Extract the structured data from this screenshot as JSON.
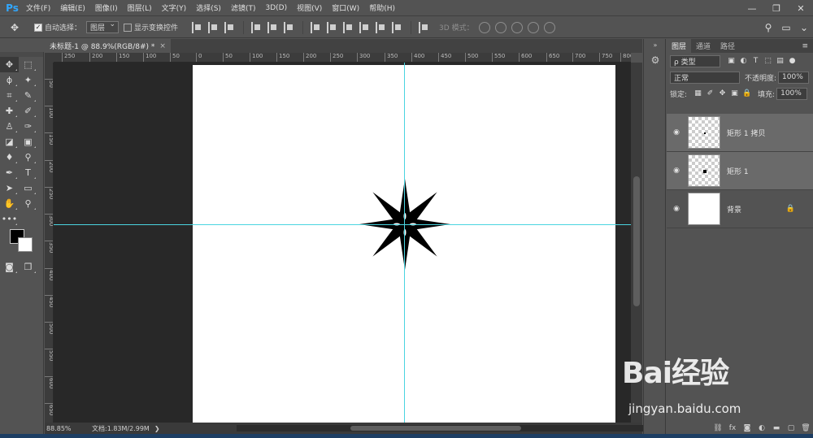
{
  "app": {
    "logo": "Ps"
  },
  "menu": {
    "items": [
      "文件(F)",
      "编辑(E)",
      "图像(I)",
      "图层(L)",
      "文字(Y)",
      "选择(S)",
      "滤镜(T)",
      "3D(D)",
      "视图(V)",
      "窗口(W)",
      "帮助(H)"
    ]
  },
  "window_controls": {
    "minimize": "—",
    "restore": "❐",
    "close": "✕"
  },
  "options": {
    "auto_select_label": "自动选择：",
    "auto_select_value": "图层",
    "show_transform_label": "显示变换控件",
    "mode3d_label": "3D 模式："
  },
  "document": {
    "tab_title": "未标题-1 @ 88.9%(RGB/8#) *",
    "tab_close": "×",
    "zoom": "88.85%",
    "doc_info": "文档:1.83M/2.99M"
  },
  "rulers": {
    "h_ticks": [
      {
        "label": "250",
        "pos": 10
      },
      {
        "label": "200",
        "pos": 44
      },
      {
        "label": "150",
        "pos": 77
      },
      {
        "label": "100",
        "pos": 110
      },
      {
        "label": "50",
        "pos": 143
      },
      {
        "label": "0",
        "pos": 175
      },
      {
        "label": "50",
        "pos": 208
      },
      {
        "label": "100",
        "pos": 241
      },
      {
        "label": "150",
        "pos": 274
      },
      {
        "label": "200",
        "pos": 307
      },
      {
        "label": "250",
        "pos": 340
      },
      {
        "label": "300",
        "pos": 373
      },
      {
        "label": "350",
        "pos": 407
      },
      {
        "label": "400",
        "pos": 440
      },
      {
        "label": "450",
        "pos": 473
      },
      {
        "label": "500",
        "pos": 506
      },
      {
        "label": "550",
        "pos": 539
      },
      {
        "label": "600",
        "pos": 572
      },
      {
        "label": "650",
        "pos": 606
      },
      {
        "label": "700",
        "pos": 638
      },
      {
        "label": "750",
        "pos": 671
      },
      {
        "label": "800",
        "pos": 697
      }
    ],
    "v_ticks": [
      {
        "label": "50",
        "pos": 20
      },
      {
        "label": "100",
        "pos": 53
      },
      {
        "label": "150",
        "pos": 86
      },
      {
        "label": "200",
        "pos": 120
      },
      {
        "label": "250",
        "pos": 153
      },
      {
        "label": "300",
        "pos": 186
      },
      {
        "label": "350",
        "pos": 219
      },
      {
        "label": "400",
        "pos": 253
      },
      {
        "label": "450",
        "pos": 286
      },
      {
        "label": "500",
        "pos": 319
      },
      {
        "label": "550",
        "pos": 352
      },
      {
        "label": "600",
        "pos": 386
      },
      {
        "label": "650",
        "pos": 419
      }
    ]
  },
  "layers_panel": {
    "tabs": [
      "图层",
      "通道",
      "路径"
    ],
    "filter_label": "ρ 类型",
    "blend_mode": "正常",
    "opacity_label": "不透明度:",
    "opacity_value": "100%",
    "lock_label": "锁定:",
    "fill_label": "填充:",
    "fill_value": "100%",
    "layers": [
      {
        "name": "矩形 1 拷贝",
        "selected": true
      },
      {
        "name": "矩形 1",
        "selected": true
      },
      {
        "name": "背景",
        "selected": false
      }
    ]
  },
  "colors": {
    "foreground": "#000000",
    "background": "#ffffff",
    "guide": "#4ad4e0",
    "accent": "#31a8ff"
  },
  "watermark": {
    "brand": "Bai经验",
    "url": "jingyan.baidu.com"
  }
}
